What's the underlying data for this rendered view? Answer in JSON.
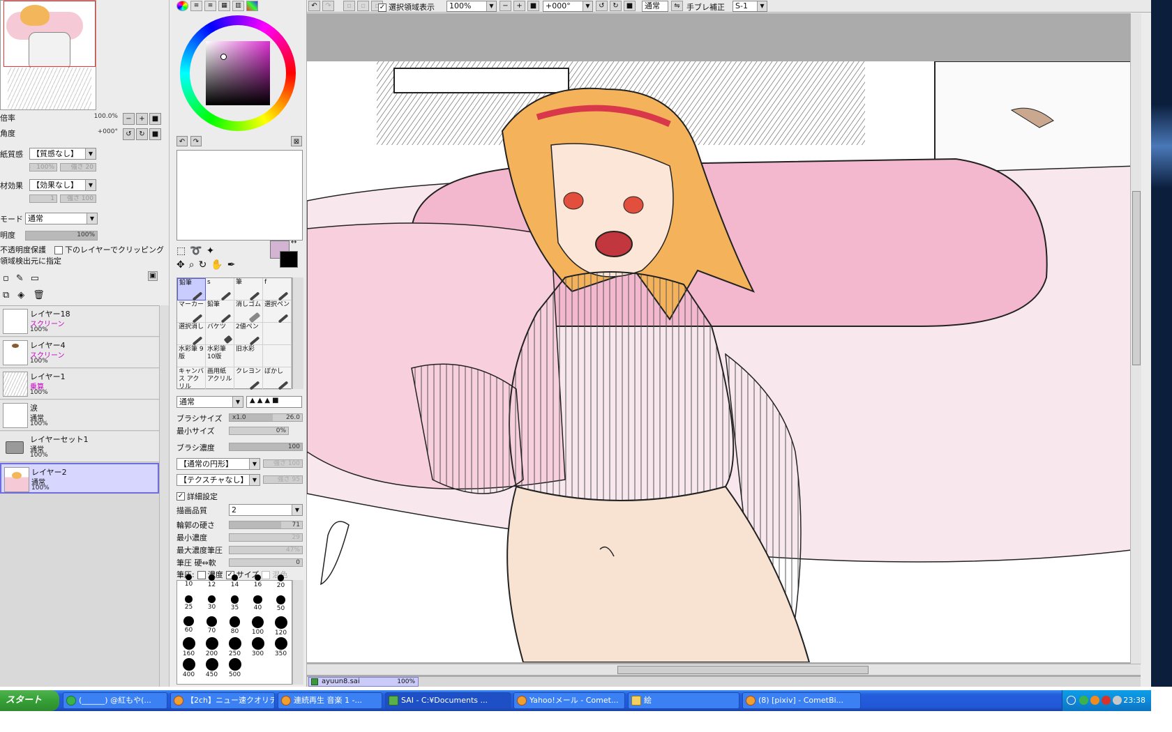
{
  "navigator": {
    "zoom_label": "倍率",
    "zoom_value": "100.0%",
    "angle_label": "角度",
    "angle_value": "+000°"
  },
  "layer_props": {
    "paper_label": "紙質感",
    "paper_value": "【質感なし】",
    "paper_amount": "100%",
    "paper_strength": "強さ 20",
    "effect_label": "材効果",
    "effect_value": "【効果なし】",
    "effect_amount": "1",
    "effect_strength": "強さ 100",
    "mode_label": "モード",
    "mode_value": "通常",
    "opacity_label": "明度",
    "opacity_value": "100%",
    "protect_label": "不透明度保護",
    "clip_label": "下のレイヤーでクリッピング",
    "detect_label": "領域検出元に指定"
  },
  "layers": [
    {
      "name": "レイヤー18",
      "mode": "スクリーン",
      "opacity": "100%"
    },
    {
      "name": "レイヤー4",
      "mode": "スクリーン",
      "opacity": "100%"
    },
    {
      "name": "レイヤー1",
      "mode": "乗算",
      "opacity": "100%"
    },
    {
      "name": "涙",
      "mode": "通常",
      "opacity": "100%"
    },
    {
      "name": "レイヤーセット1",
      "mode": "通常",
      "opacity": "100%"
    },
    {
      "name": "レイヤー2",
      "mode": "通常",
      "opacity": "100%"
    }
  ],
  "tools": [
    {
      "label": "鉛筆"
    },
    {
      "label": "s"
    },
    {
      "label": "筆"
    },
    {
      "label": "f"
    },
    {
      "label": "マーカー"
    },
    {
      "label": "鉛筆"
    },
    {
      "label": "消しゴム"
    },
    {
      "label": "選択ペン"
    },
    {
      "label": "選択消し"
    },
    {
      "label": "バケツ"
    },
    {
      "label": "2値ペン"
    },
    {
      "label": ""
    },
    {
      "label": "水彩筆 9版"
    },
    {
      "label": "水彩筆 10版"
    },
    {
      "label": "旧水彩"
    },
    {
      "label": ""
    },
    {
      "label": "キャンバス アクリル"
    },
    {
      "label": "画用紙 アクリル"
    },
    {
      "label": "クレヨン"
    },
    {
      "label": "ぼかし"
    }
  ],
  "brush": {
    "blend_mode": "通常",
    "size_label": "ブラシサイズ",
    "size_multiplier": "x1.0",
    "size_value": "26.0",
    "min_size_label": "最小サイズ",
    "min_size_value": "0%",
    "density_label": "ブラシ濃度",
    "density_value": "100",
    "shape_value": "【通常の円形】",
    "shape_strength": "強さ 100",
    "texture_value": "【テクスチャなし】",
    "texture_strength": "強さ 95",
    "detail_label": "詳細設定",
    "quality_label": "描画品質",
    "quality_value": "2",
    "hardness_label": "輪郭の硬さ",
    "hardness_value": "71",
    "min_density_label": "最小濃度",
    "min_density_value": "29",
    "max_pressure_label": "最大濃度筆圧",
    "max_pressure_value": "47%",
    "pressure_label": "筆圧 硬⇔軟",
    "pressure_value": "0",
    "pen_label": "筆圧:",
    "pen_density": "濃度",
    "pen_size": "サイズ",
    "pen_mix": "混色"
  },
  "brush_sizes": [
    "10",
    "12",
    "14",
    "16",
    "20",
    "25",
    "30",
    "35",
    "40",
    "50",
    "60",
    "70",
    "80",
    "100",
    "120",
    "160",
    "200",
    "250",
    "300",
    "350",
    "400",
    "450",
    "500"
  ],
  "toolbar": {
    "selection_label": "選択領域表示",
    "zoom_value": "100%",
    "angle_value": "+000°",
    "mode_value": "通常",
    "stabilizer_label": "手ブレ補正",
    "stabilizer_value": "S-1"
  },
  "document": {
    "filename": "ayuun8.sai",
    "zoom": "100%"
  },
  "taskbar": {
    "start_label": "スタート",
    "items": [
      {
        "label": "(______) @紅もや(..."
      },
      {
        "label": "【2ch】ニュー速クオリティ..."
      },
      {
        "label": "連続再生 音楽 1 -..."
      },
      {
        "label": "SAI - C:¥Documents ..."
      },
      {
        "label": "Yahoo!メール - Comet..."
      },
      {
        "label": "絵"
      },
      {
        "label": "(8) [pixiv] - CometBi..."
      }
    ],
    "clock": "23:38"
  },
  "colors": {
    "current_fg": "#d3b5d3",
    "current_bg": "#000000",
    "selected_layer": "#d6d6ff",
    "taskbar": "#245edb"
  }
}
